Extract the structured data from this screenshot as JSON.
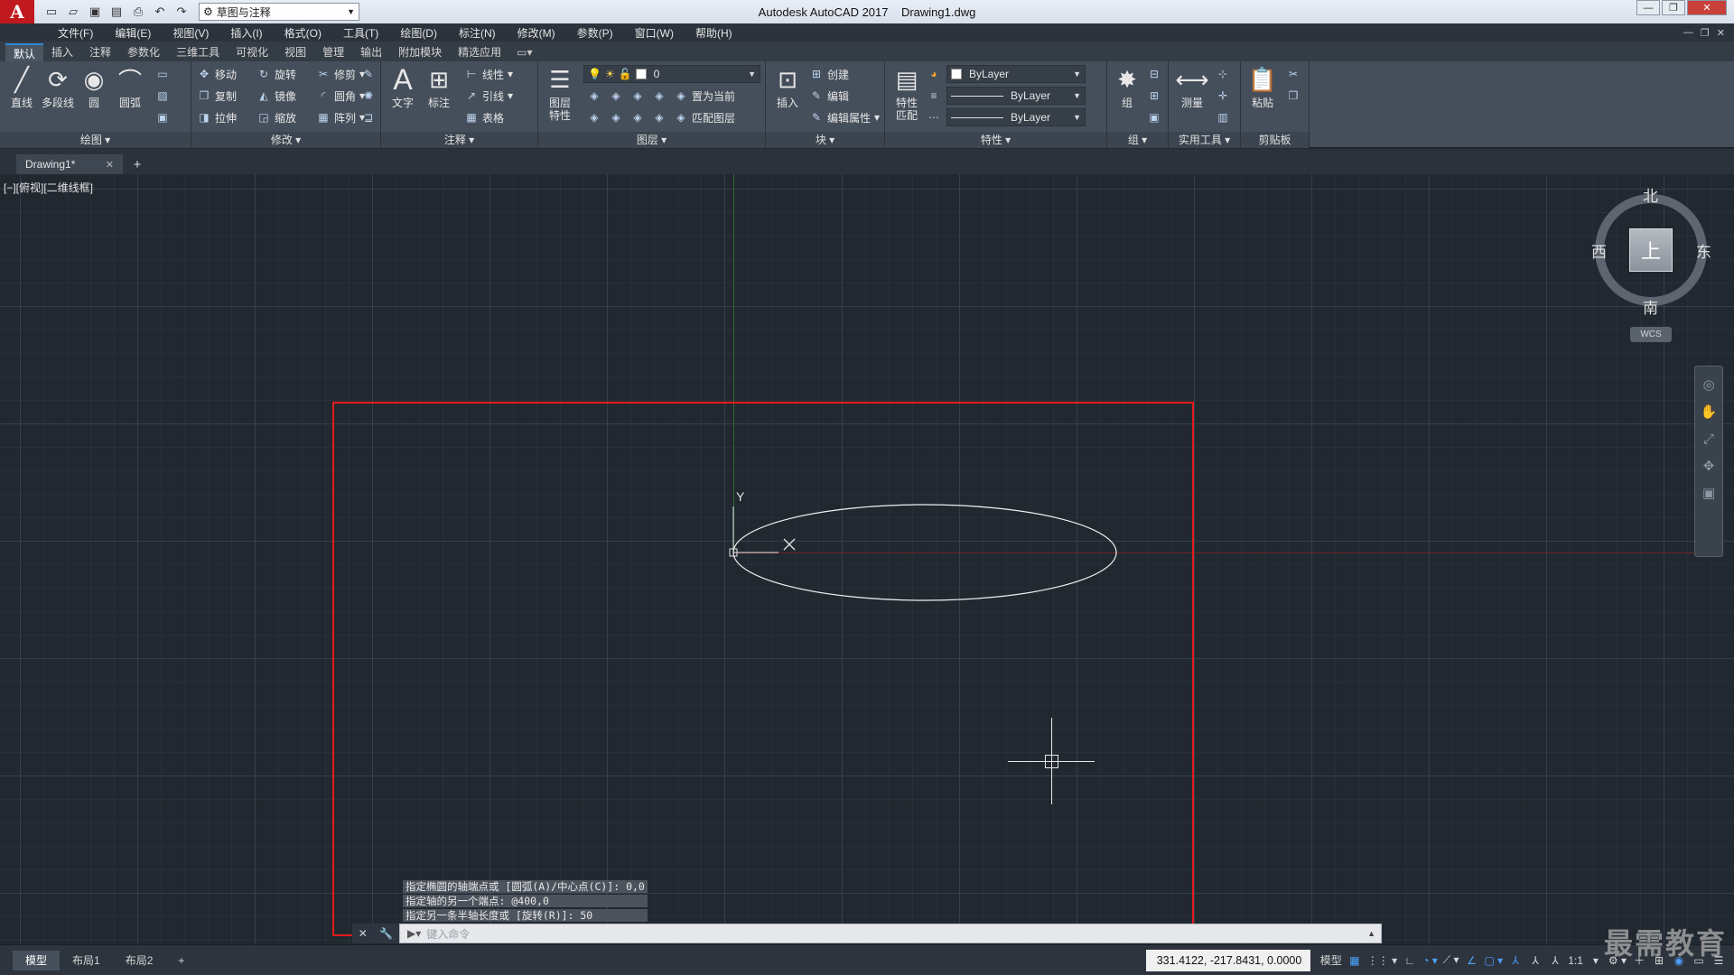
{
  "app": {
    "title": "Autodesk AutoCAD 2017",
    "document": "Drawing1.dwg",
    "workspace": "草图与注释",
    "logo_letter": "A"
  },
  "menu": [
    "文件(F)",
    "编辑(E)",
    "视图(V)",
    "插入(I)",
    "格式(O)",
    "工具(T)",
    "绘图(D)",
    "标注(N)",
    "修改(M)",
    "参数(P)",
    "窗口(W)",
    "帮助(H)"
  ],
  "ribbon_tabs": [
    "默认",
    "插入",
    "注释",
    "参数化",
    "三维工具",
    "可视化",
    "视图",
    "管理",
    "输出",
    "附加模块",
    "精选应用"
  ],
  "panels": {
    "draw": {
      "title": "绘图",
      "line": "直线",
      "polyline": "多段线",
      "circle": "圆",
      "arc": "圆弧"
    },
    "modify": {
      "title": "修改",
      "move": "移动",
      "rotate": "旋转",
      "trim": "修剪",
      "copy": "复制",
      "mirror": "镜像",
      "fillet": "圆角",
      "stretch": "拉伸",
      "scale": "缩放",
      "array": "阵列"
    },
    "annotation": {
      "title": "注释",
      "text": "文字",
      "dimension": "标注",
      "linear": "线性",
      "leader": "引线",
      "table": "表格"
    },
    "layers": {
      "title": "图层",
      "layer_props_1": "图层",
      "layer_props_2": "特性",
      "current_layer": "0",
      "make_current": "置为当前",
      "match_layer": "匹配图层"
    },
    "block": {
      "title": "块",
      "insert": "插入",
      "create": "创建",
      "edit": "编辑",
      "edit_attr": "编辑属性"
    },
    "properties": {
      "title": "特性",
      "match_1": "特性",
      "match_2": "匹配",
      "color": "ByLayer",
      "lineweight": "ByLayer",
      "linetype": "ByLayer"
    },
    "groups": {
      "title": "组",
      "group": "组"
    },
    "utilities": {
      "title": "实用工具",
      "measure": "测量"
    },
    "clipboard": {
      "title": "剪贴板",
      "paste": "粘贴"
    }
  },
  "file_tab": "Drawing1*",
  "viewport_label": "[−][俯视][二维线框]",
  "ucs": {
    "y_label": "Y"
  },
  "viewcube": {
    "north": "北",
    "south": "南",
    "west": "西",
    "east": "东",
    "face": "上",
    "wcs": "WCS"
  },
  "ellipse": {
    "center": [
      0,
      0
    ],
    "major_axis_length": 400,
    "minor_half_axis": 50
  },
  "command_history": [
    "指定椭圆的轴端点或 [圆弧(A)/中心点(C)]: 0,0",
    "指定轴的另一个端点: @400,0",
    "指定另一条半轴长度或 [旋转(R)]: 50"
  ],
  "command_placeholder": "键入命令",
  "layout_tabs": [
    "模型",
    "布局1",
    "布局2"
  ],
  "status": {
    "coordinates": "331.4122, -217.8431, 0.0000",
    "model_label": "模型",
    "scale": "1:1"
  },
  "watermark": "最需教育"
}
